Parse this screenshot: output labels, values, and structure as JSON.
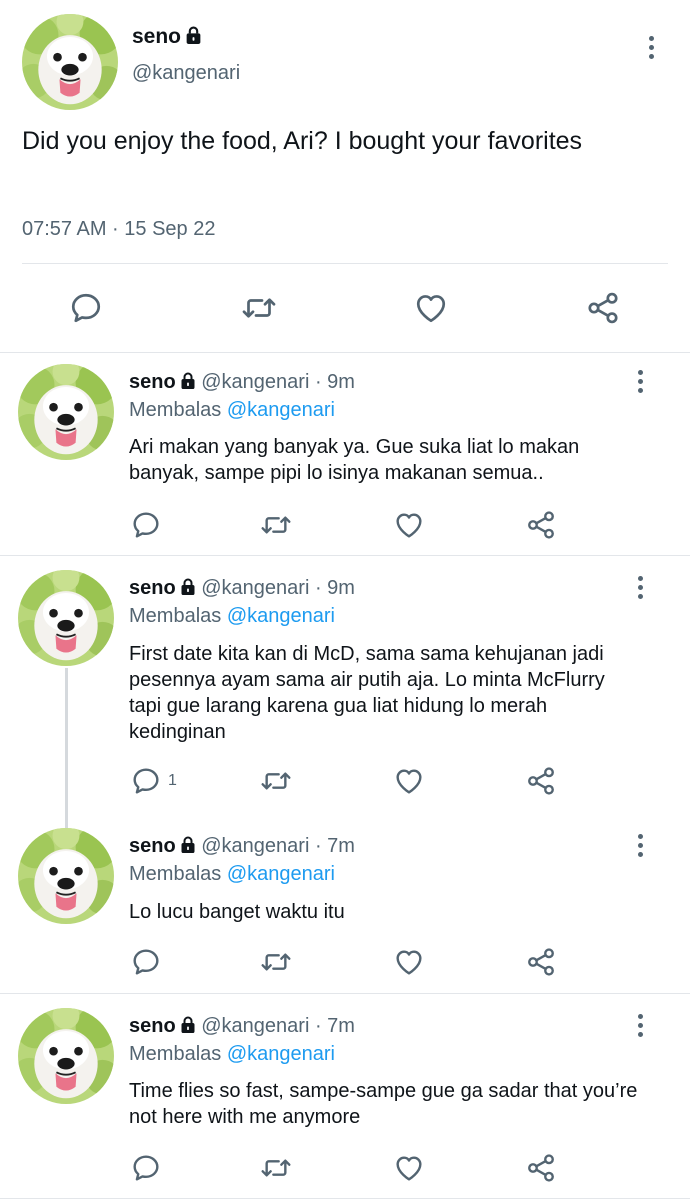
{
  "main": {
    "name": "seno",
    "handle": "@kangenari",
    "text": "Did you enjoy the food, Ari? I bought your favorites",
    "timestamp": "07:57 AM · 15 Sep 22"
  },
  "replies": [
    {
      "name": "seno",
      "handle": "@kangenari",
      "time": "· 9m",
      "replying_prefix": "Membalas",
      "replying_handle": "@kangenari",
      "text": "Ari makan yang banyak ya. Gue suka liat lo makan banyak, sampe pipi lo isinya makanan semua..",
      "reply_count": ""
    },
    {
      "name": "seno",
      "handle": "@kangenari",
      "time": "· 9m",
      "replying_prefix": "Membalas",
      "replying_handle": "@kangenari",
      "text": "First date kita kan di McD, sama sama kehujanan jadi pesennya ayam sama air putih aja. Lo minta McFlurry tapi gue larang karena gua liat hidung lo merah kedinginan",
      "reply_count": "1"
    },
    {
      "name": "seno",
      "handle": "@kangenari",
      "time": "· 7m",
      "replying_prefix": "Membalas",
      "replying_handle": "@kangenari",
      "text": "Lo lucu banget waktu itu",
      "reply_count": ""
    },
    {
      "name": "seno",
      "handle": "@kangenari",
      "time": "· 7m",
      "replying_prefix": "Membalas",
      "replying_handle": "@kangenari",
      "text": "Time flies so fast, sampe-sampe gue ga sadar that you’re not here with me anymore",
      "reply_count": ""
    }
  ],
  "icons": {
    "reply": "reply-icon",
    "retweet": "retweet-icon",
    "like": "like-icon",
    "share": "share-icon",
    "lock": "lock-icon",
    "more": "more-icon"
  },
  "colors": {
    "link": "#1d9bf0",
    "muted": "#536471",
    "text": "#0f1419",
    "icon": "#536471"
  }
}
